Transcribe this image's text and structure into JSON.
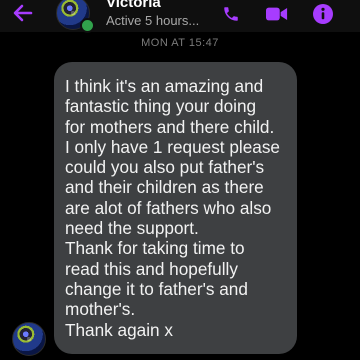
{
  "header": {
    "name": "Victoria",
    "subtitle": "Active 5 hours...",
    "accent_color": "#a73cff",
    "icons": [
      "back-arrow-icon",
      "phone-icon",
      "video-icon",
      "info-icon"
    ]
  },
  "conversation": {
    "timestamp": "MON AT 15:47",
    "message_lines": [
      "I think it's an amazing and",
      "fantastic thing your doing",
      "for mothers and there child.",
      "I only have 1 request please",
      "could you also put father's",
      "and their children as there",
      "are alot of fathers who also",
      "need the support.",
      "Thank for taking time to",
      "read this and hopefully",
      "change it to father's and",
      "mother's.",
      "Thank again x"
    ]
  }
}
